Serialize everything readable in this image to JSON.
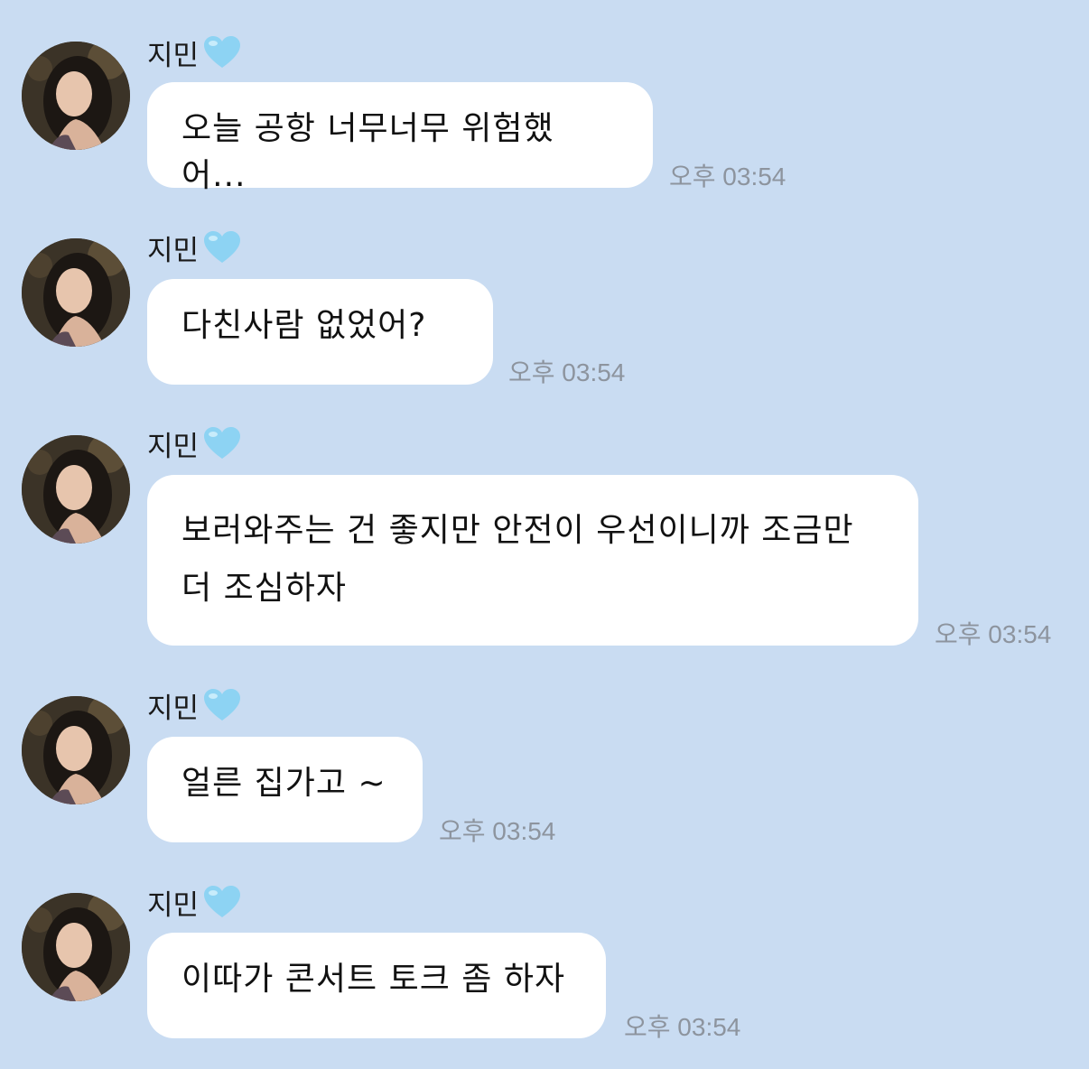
{
  "chat": {
    "accent_background": "#c9dcf2",
    "bubble_color": "#ffffff",
    "messages": [
      {
        "sender": "지민",
        "sender_icon": "light-blue-heart-icon",
        "text": "오늘 공항 너무너무 위험했어...",
        "time": "오후 03:54"
      },
      {
        "sender": "지민",
        "sender_icon": "light-blue-heart-icon",
        "text": "다친사람 없었어?",
        "time": "오후 03:54"
      },
      {
        "sender": "지민",
        "sender_icon": "light-blue-heart-icon",
        "text": "보러와주는 건 좋지만 안전이 우선이니까 조금만 더 조심하자",
        "time": "오후 03:54"
      },
      {
        "sender": "지민",
        "sender_icon": "light-blue-heart-icon",
        "text": "얼른 집가고 ~",
        "time": "오후 03:54"
      },
      {
        "sender": "지민",
        "sender_icon": "light-blue-heart-icon",
        "text": "이따가 콘서트 토크 좀 하자",
        "time": "오후 03:54"
      }
    ]
  }
}
